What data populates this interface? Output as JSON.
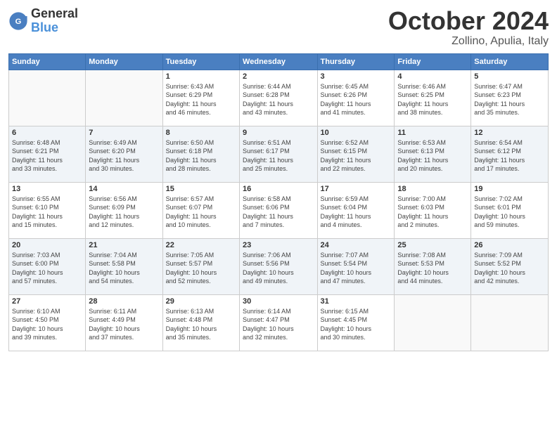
{
  "header": {
    "logo_general": "General",
    "logo_blue": "Blue",
    "month": "October 2024",
    "location": "Zollino, Apulia, Italy"
  },
  "weekdays": [
    "Sunday",
    "Monday",
    "Tuesday",
    "Wednesday",
    "Thursday",
    "Friday",
    "Saturday"
  ],
  "weeks": [
    [
      {
        "day": "",
        "info": ""
      },
      {
        "day": "",
        "info": ""
      },
      {
        "day": "1",
        "info": "Sunrise: 6:43 AM\nSunset: 6:29 PM\nDaylight: 11 hours\nand 46 minutes."
      },
      {
        "day": "2",
        "info": "Sunrise: 6:44 AM\nSunset: 6:28 PM\nDaylight: 11 hours\nand 43 minutes."
      },
      {
        "day": "3",
        "info": "Sunrise: 6:45 AM\nSunset: 6:26 PM\nDaylight: 11 hours\nand 41 minutes."
      },
      {
        "day": "4",
        "info": "Sunrise: 6:46 AM\nSunset: 6:25 PM\nDaylight: 11 hours\nand 38 minutes."
      },
      {
        "day": "5",
        "info": "Sunrise: 6:47 AM\nSunset: 6:23 PM\nDaylight: 11 hours\nand 35 minutes."
      }
    ],
    [
      {
        "day": "6",
        "info": "Sunrise: 6:48 AM\nSunset: 6:21 PM\nDaylight: 11 hours\nand 33 minutes."
      },
      {
        "day": "7",
        "info": "Sunrise: 6:49 AM\nSunset: 6:20 PM\nDaylight: 11 hours\nand 30 minutes."
      },
      {
        "day": "8",
        "info": "Sunrise: 6:50 AM\nSunset: 6:18 PM\nDaylight: 11 hours\nand 28 minutes."
      },
      {
        "day": "9",
        "info": "Sunrise: 6:51 AM\nSunset: 6:17 PM\nDaylight: 11 hours\nand 25 minutes."
      },
      {
        "day": "10",
        "info": "Sunrise: 6:52 AM\nSunset: 6:15 PM\nDaylight: 11 hours\nand 22 minutes."
      },
      {
        "day": "11",
        "info": "Sunrise: 6:53 AM\nSunset: 6:13 PM\nDaylight: 11 hours\nand 20 minutes."
      },
      {
        "day": "12",
        "info": "Sunrise: 6:54 AM\nSunset: 6:12 PM\nDaylight: 11 hours\nand 17 minutes."
      }
    ],
    [
      {
        "day": "13",
        "info": "Sunrise: 6:55 AM\nSunset: 6:10 PM\nDaylight: 11 hours\nand 15 minutes."
      },
      {
        "day": "14",
        "info": "Sunrise: 6:56 AM\nSunset: 6:09 PM\nDaylight: 11 hours\nand 12 minutes."
      },
      {
        "day": "15",
        "info": "Sunrise: 6:57 AM\nSunset: 6:07 PM\nDaylight: 11 hours\nand 10 minutes."
      },
      {
        "day": "16",
        "info": "Sunrise: 6:58 AM\nSunset: 6:06 PM\nDaylight: 11 hours\nand 7 minutes."
      },
      {
        "day": "17",
        "info": "Sunrise: 6:59 AM\nSunset: 6:04 PM\nDaylight: 11 hours\nand 4 minutes."
      },
      {
        "day": "18",
        "info": "Sunrise: 7:00 AM\nSunset: 6:03 PM\nDaylight: 11 hours\nand 2 minutes."
      },
      {
        "day": "19",
        "info": "Sunrise: 7:02 AM\nSunset: 6:01 PM\nDaylight: 10 hours\nand 59 minutes."
      }
    ],
    [
      {
        "day": "20",
        "info": "Sunrise: 7:03 AM\nSunset: 6:00 PM\nDaylight: 10 hours\nand 57 minutes."
      },
      {
        "day": "21",
        "info": "Sunrise: 7:04 AM\nSunset: 5:58 PM\nDaylight: 10 hours\nand 54 minutes."
      },
      {
        "day": "22",
        "info": "Sunrise: 7:05 AM\nSunset: 5:57 PM\nDaylight: 10 hours\nand 52 minutes."
      },
      {
        "day": "23",
        "info": "Sunrise: 7:06 AM\nSunset: 5:56 PM\nDaylight: 10 hours\nand 49 minutes."
      },
      {
        "day": "24",
        "info": "Sunrise: 7:07 AM\nSunset: 5:54 PM\nDaylight: 10 hours\nand 47 minutes."
      },
      {
        "day": "25",
        "info": "Sunrise: 7:08 AM\nSunset: 5:53 PM\nDaylight: 10 hours\nand 44 minutes."
      },
      {
        "day": "26",
        "info": "Sunrise: 7:09 AM\nSunset: 5:52 PM\nDaylight: 10 hours\nand 42 minutes."
      }
    ],
    [
      {
        "day": "27",
        "info": "Sunrise: 6:10 AM\nSunset: 4:50 PM\nDaylight: 10 hours\nand 39 minutes."
      },
      {
        "day": "28",
        "info": "Sunrise: 6:11 AM\nSunset: 4:49 PM\nDaylight: 10 hours\nand 37 minutes."
      },
      {
        "day": "29",
        "info": "Sunrise: 6:13 AM\nSunset: 4:48 PM\nDaylight: 10 hours\nand 35 minutes."
      },
      {
        "day": "30",
        "info": "Sunrise: 6:14 AM\nSunset: 4:47 PM\nDaylight: 10 hours\nand 32 minutes."
      },
      {
        "day": "31",
        "info": "Sunrise: 6:15 AM\nSunset: 4:45 PM\nDaylight: 10 hours\nand 30 minutes."
      },
      {
        "day": "",
        "info": ""
      },
      {
        "day": "",
        "info": ""
      }
    ]
  ]
}
